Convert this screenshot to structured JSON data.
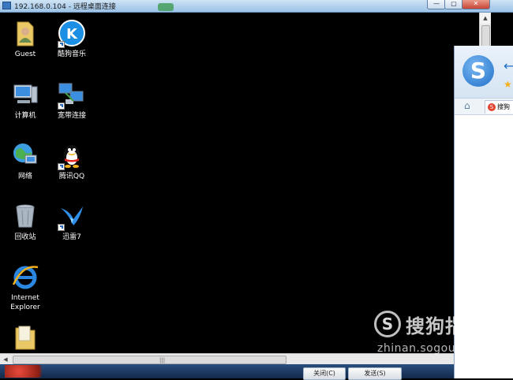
{
  "window": {
    "title": "192.168.0.104 - 远程桌面连接",
    "min_glyph": "—",
    "max_glyph": "▢",
    "close_glyph": "✕"
  },
  "desktop_icons": [
    {
      "label": "Guest",
      "icon": "user-folder-icon"
    },
    {
      "label": "酷狗音乐",
      "icon": "kugou-music-icon"
    },
    {
      "label": "计算机",
      "icon": "computer-icon"
    },
    {
      "label": "宽带连接",
      "icon": "broadband-connection-icon"
    },
    {
      "label": "网络",
      "icon": "network-icon"
    },
    {
      "label": "腾讯QQ",
      "icon": "qq-penguin-icon"
    },
    {
      "label": "回收站",
      "icon": "recycle-bin-icon"
    },
    {
      "label": "迅雷7",
      "icon": "xunlei-bird-icon"
    },
    {
      "label": "Internet Explorer",
      "icon": "internet-explorer-icon"
    },
    {
      "label": "",
      "icon": "folder-icon"
    }
  ],
  "taskbar": {
    "button1": "关闭(C)",
    "button2": "发送(S)"
  },
  "browser": {
    "logo_letter": "S",
    "back_glyph": "←",
    "star_glyph": "★",
    "home_glyph": "⌂",
    "tab_label": "搜狗"
  },
  "watermark": {
    "logo_letter": "S",
    "cn": "搜狗指南",
    "en": "zhinan.sogou.com"
  },
  "colors": {
    "desktop_bg": "#000000",
    "title_bar": "#b9d3ee",
    "accent": "#1f6fc9"
  }
}
